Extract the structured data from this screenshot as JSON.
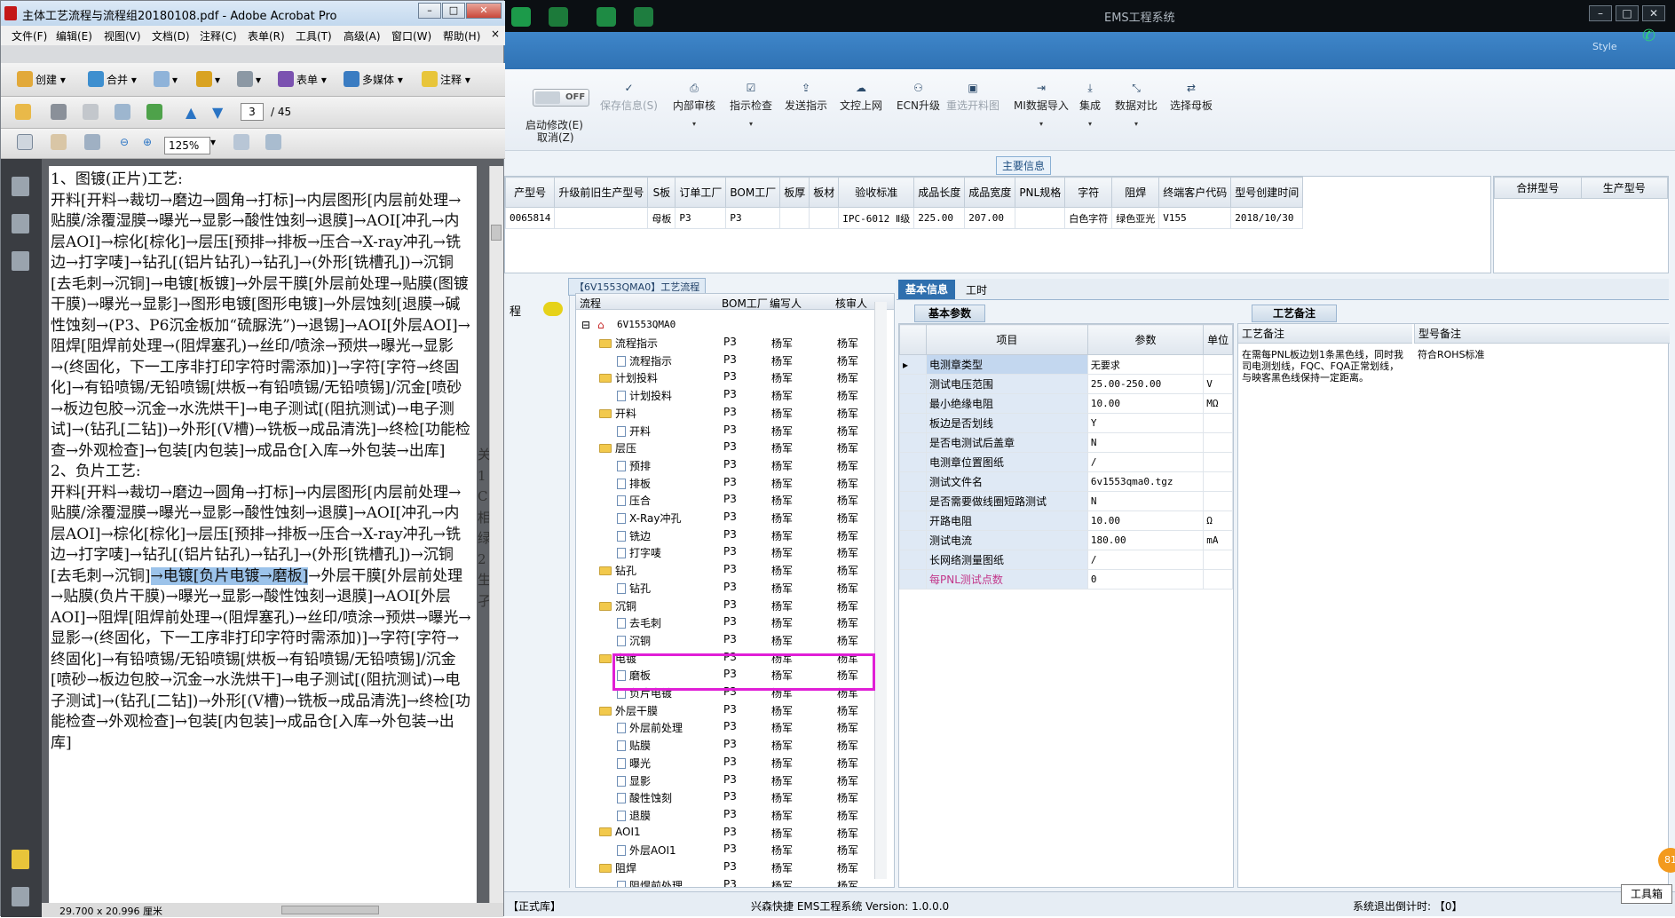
{
  "ems": {
    "title": "EMS工程系统",
    "style_label": "Style",
    "ribbon": {
      "toggle_text": "OFF",
      "start_edit": "启动修改(E)",
      "cancel": "取消(Z)",
      "save_info": "保存信息(S)",
      "internal_review": "内部审核",
      "indicator_check": "指示检查",
      "send_indicator": "发送指示",
      "upload_doc": "文控上网",
      "ecn_upgrade": "ECN升级",
      "redraw_process": "重选开料图",
      "mi_import": "MI数据导入",
      "integrate": "集成",
      "data_compare": "数据对比",
      "select_mother": "选择母板"
    },
    "main_info": {
      "header": "主要信息",
      "columns": [
        "产型号",
        "升级前旧生产型号",
        "S板",
        "订单工厂",
        "BOM工厂",
        "板厚",
        "板材",
        "验收标准",
        "成品长度",
        "成品宽度",
        "PNL规格",
        "字符",
        "阻焊",
        "终端客户代码",
        "型号创建时间"
      ],
      "row": [
        "0065814",
        "",
        "母板",
        "P3",
        "P3",
        "",
        "",
        "IPC-6012 Ⅱ级",
        "225.00",
        "207.00",
        "",
        "白色字符",
        "绿色亚光",
        "V155",
        "2018/10/30"
      ],
      "side_columns": [
        "合拼型号",
        "生产型号"
      ]
    },
    "process": {
      "tab_label": "【6V1553QMA0】工艺流程",
      "strip_label": "程",
      "columns": [
        "流程",
        "BOM工厂",
        "编写人",
        "核审人"
      ],
      "root": "6V1553QMA0",
      "rows": [
        {
          "name": "流程指示",
          "folder": true,
          "bom": "P3",
          "writer": "杨军",
          "reviewer": "杨军"
        },
        {
          "name": "流程指示",
          "folder": false,
          "bom": "P3",
          "writer": "杨军",
          "reviewer": "杨军"
        },
        {
          "name": "计划投料",
          "folder": true,
          "bom": "P3",
          "writer": "杨军",
          "reviewer": "杨军"
        },
        {
          "name": "计划投料",
          "folder": false,
          "bom": "P3",
          "writer": "杨军",
          "reviewer": "杨军"
        },
        {
          "name": "开料",
          "folder": true,
          "bom": "P3",
          "writer": "杨军",
          "reviewer": "杨军"
        },
        {
          "name": "开料",
          "folder": false,
          "bom": "P3",
          "writer": "杨军",
          "reviewer": "杨军"
        },
        {
          "name": "层压",
          "folder": true,
          "bom": "P3",
          "writer": "杨军",
          "reviewer": "杨军"
        },
        {
          "name": "预排",
          "folder": false,
          "bom": "P3",
          "writer": "杨军",
          "reviewer": "杨军"
        },
        {
          "name": "排板",
          "folder": false,
          "bom": "P3",
          "writer": "杨军",
          "reviewer": "杨军"
        },
        {
          "name": "压合",
          "folder": false,
          "bom": "P3",
          "writer": "杨军",
          "reviewer": "杨军"
        },
        {
          "name": "X-Ray冲孔",
          "folder": false,
          "bom": "P3",
          "writer": "杨军",
          "reviewer": "杨军"
        },
        {
          "name": "铣边",
          "folder": false,
          "bom": "P3",
          "writer": "杨军",
          "reviewer": "杨军"
        },
        {
          "name": "打字唛",
          "folder": false,
          "bom": "P3",
          "writer": "杨军",
          "reviewer": "杨军"
        },
        {
          "name": "钻孔",
          "folder": true,
          "bom": "P3",
          "writer": "杨军",
          "reviewer": "杨军"
        },
        {
          "name": "钻孔",
          "folder": false,
          "bom": "P3",
          "writer": "杨军",
          "reviewer": "杨军"
        },
        {
          "name": "沉铜",
          "folder": true,
          "bom": "P3",
          "writer": "杨军",
          "reviewer": "杨军"
        },
        {
          "name": "去毛刺",
          "folder": false,
          "bom": "P3",
          "writer": "杨军",
          "reviewer": "杨军"
        },
        {
          "name": "沉铜",
          "folder": false,
          "bom": "P3",
          "writer": "杨军",
          "reviewer": "杨军"
        },
        {
          "name": "电镀",
          "folder": true,
          "bom": "P3",
          "writer": "杨军",
          "reviewer": "杨军"
        },
        {
          "name": "磨板",
          "folder": false,
          "bom": "P3",
          "writer": "杨军",
          "reviewer": "杨军"
        },
        {
          "name": "负片电镀",
          "folder": false,
          "bom": "P3",
          "writer": "杨军",
          "reviewer": "杨军"
        },
        {
          "name": "外层干膜",
          "folder": true,
          "bom": "P3",
          "writer": "杨军",
          "reviewer": "杨军"
        },
        {
          "name": "外层前处理",
          "folder": false,
          "bom": "P3",
          "writer": "杨军",
          "reviewer": "杨军"
        },
        {
          "name": "贴膜",
          "folder": false,
          "bom": "P3",
          "writer": "杨军",
          "reviewer": "杨军"
        },
        {
          "name": "曝光",
          "folder": false,
          "bom": "P3",
          "writer": "杨军",
          "reviewer": "杨军"
        },
        {
          "name": "显影",
          "folder": false,
          "bom": "P3",
          "writer": "杨军",
          "reviewer": "杨军"
        },
        {
          "name": "酸性蚀刻",
          "folder": false,
          "bom": "P3",
          "writer": "杨军",
          "reviewer": "杨军"
        },
        {
          "name": "退膜",
          "folder": false,
          "bom": "P3",
          "writer": "杨军",
          "reviewer": "杨军"
        },
        {
          "name": "AOI1",
          "folder": true,
          "bom": "P3",
          "writer": "杨军",
          "reviewer": "杨军"
        },
        {
          "name": "外层AOI1",
          "folder": false,
          "bom": "P3",
          "writer": "杨军",
          "reviewer": "杨军"
        },
        {
          "name": "阻焊",
          "folder": true,
          "bom": "P3",
          "writer": "杨军",
          "reviewer": "杨军"
        },
        {
          "name": "阻焊前处理",
          "folder": false,
          "bom": "P3",
          "writer": "杨军",
          "reviewer": "杨军"
        }
      ]
    },
    "basic": {
      "tab_basic": "基本信息",
      "tab_hours": "工时",
      "param_tab": "基本参数",
      "columns": [
        "项目",
        "参数",
        "单位"
      ],
      "rows": [
        {
          "item": "电测章类型",
          "value": "无要求",
          "unit": ""
        },
        {
          "item": "测试电压范围",
          "value": "25.00-250.00",
          "unit": "V"
        },
        {
          "item": "最小绝缘电阻",
          "value": "10.00",
          "unit": "MΩ"
        },
        {
          "item": "板边是否划线",
          "value": "Y",
          "unit": ""
        },
        {
          "item": "是否电测试后盖章",
          "value": "N",
          "unit": ""
        },
        {
          "item": "电测章位置图纸",
          "value": "/",
          "unit": ""
        },
        {
          "item": "测试文件名",
          "value": "6v1553qma0.tgz",
          "unit": ""
        },
        {
          "item": "是否需要做线圈短路测试",
          "value": "N",
          "unit": ""
        },
        {
          "item": "开路电阻",
          "value": "10.00",
          "unit": "Ω"
        },
        {
          "item": "测试电流",
          "value": "180.00",
          "unit": "mA"
        },
        {
          "item": "长网络测量图纸",
          "value": "/",
          "unit": ""
        },
        {
          "item": "每PNL测试点数",
          "value": "0",
          "unit": ""
        }
      ]
    },
    "notes": {
      "tab": "工艺备注",
      "col1": "工艺备注",
      "col2": "型号备注",
      "note1": "在需每PNL板边划1条黑色线，同时我司电测划线，FQC、FQA正常划线，与映客黑色线保持一定距离。",
      "note2": "符合ROHS标准"
    },
    "status": {
      "db": "【正式库】",
      "version": "兴森快捷 EMS工程系统 Version: 1.0.0.0",
      "logout": "系统退出倒计时: 【0】",
      "toolbox": "工具箱",
      "badge": "81"
    }
  },
  "acrobat": {
    "title": "主体工艺流程与流程组20180108.pdf - Adobe Acrobat Pro",
    "menu": [
      "文件(F)",
      "编辑(E)",
      "视图(V)",
      "文档(D)",
      "注释(C)",
      "表单(R)",
      "工具(T)",
      "高级(A)",
      "窗口(W)",
      "帮助(H)"
    ],
    "toolbar": [
      "创建",
      "合并",
      "表单",
      "多媒体",
      "注释"
    ],
    "page_current": "3",
    "page_total": "/ 45",
    "zoom": "125%",
    "status_size": "29.700 x 20.996 厘米",
    "doc": {
      "before_highlight": "1、图镀(正片)工艺:\n开料[开料→裁切→磨边→圆角→打标]→内层图形[内层前处理→贴膜/涂覆湿膜→曝光→显影→酸性蚀刻→退膜]→AOI[冲孔→内层AOI]→棕化[棕化]→层压[预排→排板→压合→X-ray冲孔→铣边→打字唛]→钻孔[(铝片钻孔)→钻孔]→(外形[铣槽孔])→沉铜[去毛刺→沉铜]→电镀[板镀]→外层干膜[外层前处理→贴膜(图镀干膜)→曝光→显影]→图形电镀[图形电镀]→外层蚀刻[退膜→碱性蚀刻→(P3、P6沉金板加“硫脲洗”)→退锡]→AOI[外层AOI]→阻焊[阻焊前处理→(阻焊塞孔)→丝印/喷涂→预烘→曝光→显影→(终固化，下一工序非打印字符时需添加)]→字符[字符→终固化]→有铅喷锡/无铅喷锡[烘板→有铅喷锡/无铅喷锡]/沉金[喷砂→板边包胶→沉金→水洗烘干]→电子测试[(阻抗测试)→电子测试]→(钻孔[二钻])→外形[(V槽)→铣板→成品清洗]→终检[功能检查→外观检查]→包装[内包装]→成品仓[入库→外包装→出库]\n2、负片工艺:\n开料[开料→裁切→磨边→圆角→打标]→内层图形[内层前处理→贴膜/涂覆湿膜→曝光→显影→酸性蚀刻→退膜]→AOI[冲孔→内层AOI]→棕化[棕化]→层压[预排→排板→压合→X-ray冲孔→铣边→打字唛]→钻孔[(铝片钻孔)→钻孔]→(外形[铣槽孔])→沉铜[去毛刺→沉铜]",
      "highlight": "→电镀[负片电镀→磨板]",
      "after_highlight": "→外层干膜[外层前处理→贴膜(负片干膜)→曝光→显影→酸性蚀刻→退膜]→AOI[外层AOI]→阻焊[阻焊前处理→(阻焊塞孔)→丝印/喷涂→预烘→曝光→显影→(终固化，下一工序非打印字符时需添加)]→字符[字符→终固化]→有铅喷锡/无铅喷锡[烘板→有铅喷锡/无铅喷锡]/沉金[喷砂→板边包胶→沉金→水洗烘干]→电子测试[(阻抗测试)→电子测试]→(钻孔[二钻])→外形[(V槽)→铣板→成品清洗]→终检[功能检查→外观检查]→包装[内包装]→成品仓[入库→外包装→出库]",
      "side_fragment": [
        "关",
        "1",
        "C",
        "相",
        "绿",
        "2",
        "生",
        "孑"
      ]
    }
  }
}
